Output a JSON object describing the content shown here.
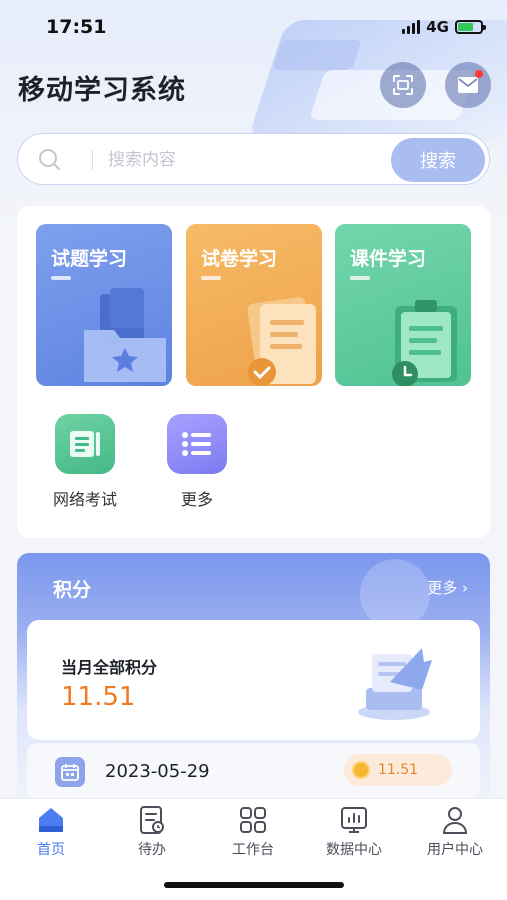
{
  "status_bar": {
    "time": "17:51",
    "network": "4G"
  },
  "header": {
    "title": "移动学习系统"
  },
  "search": {
    "placeholder": "搜索内容",
    "button_label": "搜索"
  },
  "study_cards": [
    {
      "label": "试题学习",
      "color": "#6a8ce6"
    },
    {
      "label": "试卷学习",
      "color": "#f2ad58"
    },
    {
      "label": "课件学习",
      "color": "#5fcc9f"
    }
  ],
  "quick_entries": [
    {
      "label": "网络考试",
      "icon": "exam-doc-icon"
    },
    {
      "label": "更多",
      "icon": "list-more-icon"
    }
  ],
  "points": {
    "title": "积分",
    "more_label": "更多",
    "month_label": "当月全部积分",
    "month_value": "11.51",
    "records": [
      {
        "date": "2023-05-29",
        "score": "11.51"
      }
    ]
  },
  "tabbar": {
    "items": [
      {
        "label": "首页",
        "icon": "home-icon",
        "active": true
      },
      {
        "label": "待办",
        "icon": "todo-icon",
        "active": false
      },
      {
        "label": "工作台",
        "icon": "workbench-icon",
        "active": false
      },
      {
        "label": "数据中心",
        "icon": "data-center-icon",
        "active": false
      },
      {
        "label": "用户中心",
        "icon": "user-icon",
        "active": false
      }
    ]
  },
  "colors": {
    "accent": "#4d7cf0",
    "score": "#f07a24",
    "search_button": "#a9bdf0"
  }
}
